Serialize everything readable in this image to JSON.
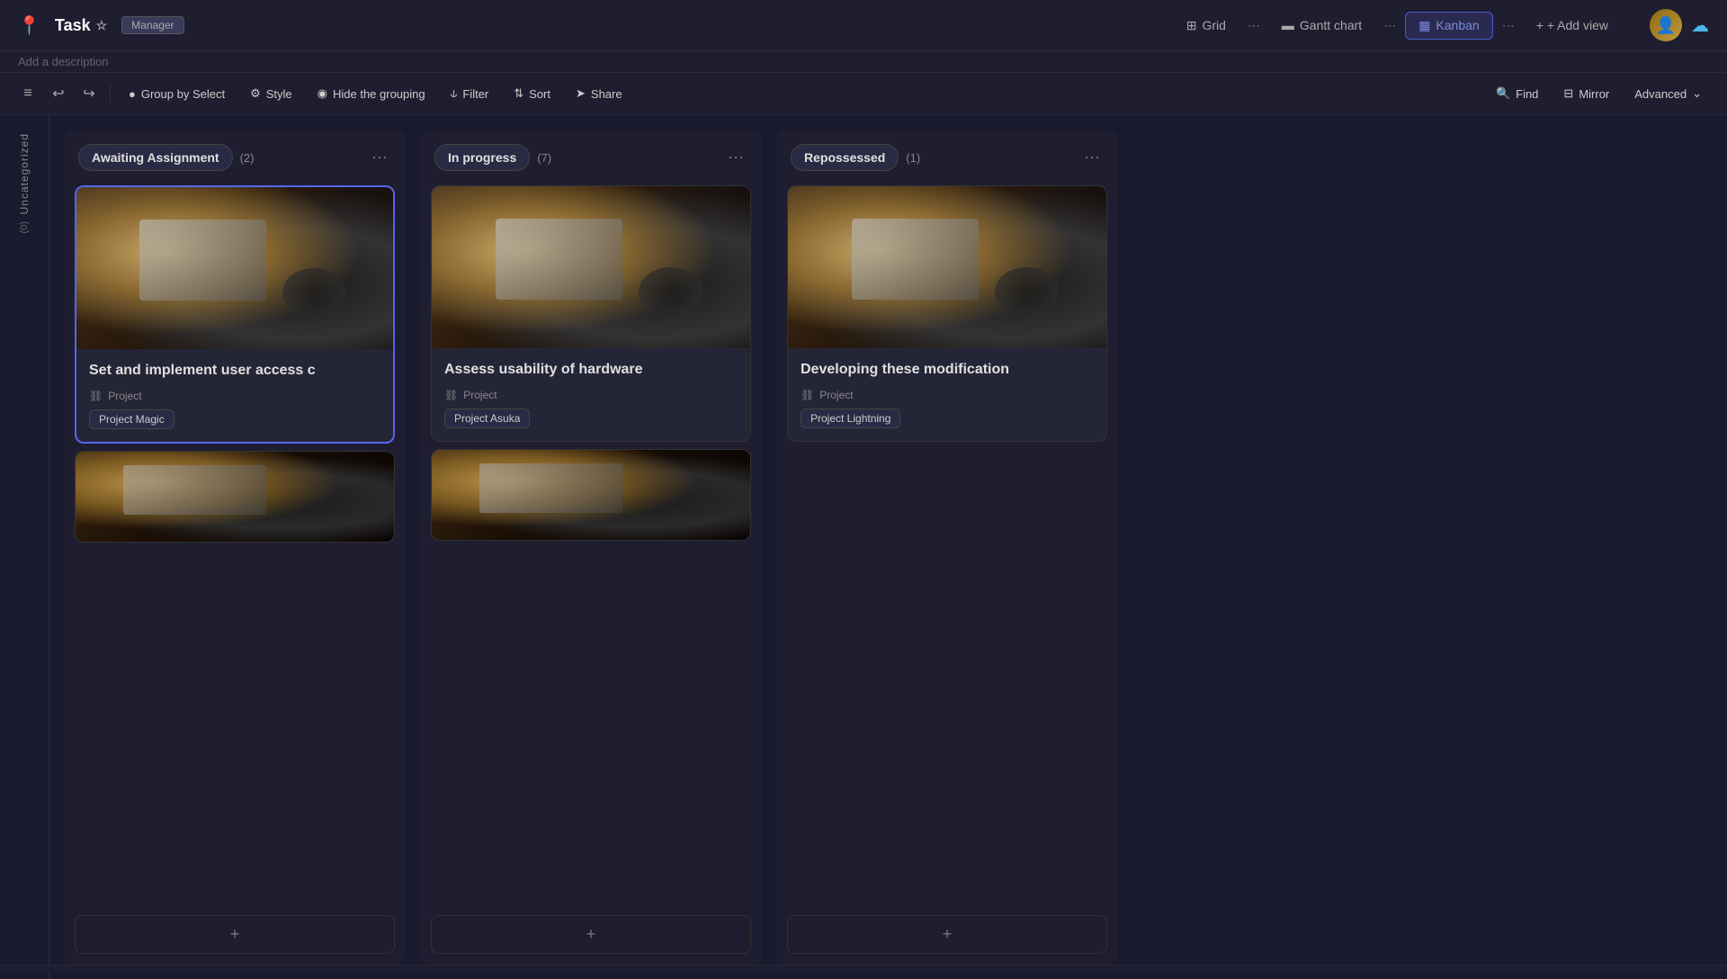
{
  "app": {
    "icon": "📍",
    "title": "Task",
    "star_icon": "☆",
    "badge": "Manager",
    "description": "Add a description"
  },
  "views": {
    "tabs": [
      {
        "id": "grid",
        "label": "Grid",
        "icon": "⊞",
        "active": false
      },
      {
        "id": "gantt",
        "label": "Gantt chart",
        "icon": "≡",
        "active": false
      },
      {
        "id": "kanban",
        "label": "Kanban",
        "icon": "▦",
        "active": true
      }
    ],
    "add_view": "+ Add view"
  },
  "toolbar": {
    "nav_left": "←",
    "nav_right": "→",
    "group_by": "Group by Select",
    "style": "Style",
    "hide_grouping": "Hide the grouping",
    "filter": "Filter",
    "sort": "Sort",
    "share": "Share",
    "find": "Find",
    "mirror": "Mirror",
    "advanced": "Advanced",
    "advanced_arrow": "∨"
  },
  "sidebar": {
    "label": "Uncategorized",
    "count": "(0)"
  },
  "columns": [
    {
      "id": "awaiting",
      "title": "Awaiting Assignment",
      "count": 2,
      "cards": [
        {
          "id": "card1",
          "title": "Set and implement user access c",
          "project_label": "Project",
          "project_name": "Project Magic",
          "selected": true
        }
      ],
      "has_partial": true
    },
    {
      "id": "in_progress",
      "title": "In progress",
      "count": 7,
      "cards": [
        {
          "id": "card2",
          "title": "Assess usability of hardware",
          "project_label": "Project",
          "project_name": "Project Asuka",
          "selected": false
        }
      ],
      "has_partial": true
    },
    {
      "id": "repossessed",
      "title": "Repossessed",
      "count": 1,
      "cards": [
        {
          "id": "card3",
          "title": "Developing these modification",
          "project_label": "Project",
          "project_name": "Project Lightning",
          "selected": false
        }
      ],
      "has_partial": false
    }
  ],
  "icons": {
    "grid": "⊞",
    "gantt": "≡",
    "kanban": "▦",
    "plus": "+",
    "dots": "⋯",
    "circle": "●",
    "gear": "⚙",
    "eye": "◉",
    "funnel": "⫝",
    "arrows": "⇅",
    "send": "➤",
    "search": "🔍",
    "columns": "⊟",
    "chevron": "⌄",
    "link": "⛓",
    "undo": "↩",
    "redo": "↪",
    "nav_icon": "≡",
    "layout_icon": "⊟"
  }
}
